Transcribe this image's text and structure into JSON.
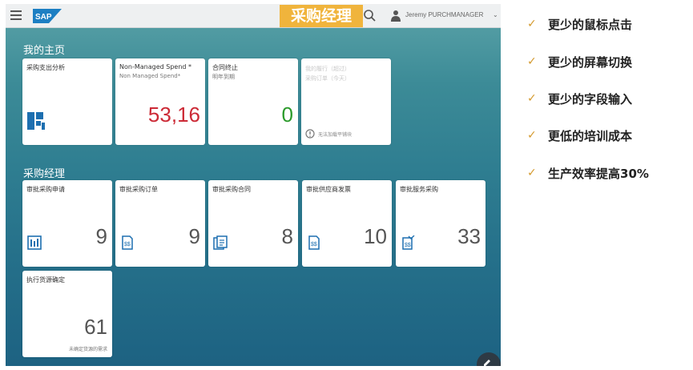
{
  "shell": {
    "logo_text": "SAP",
    "title": "采购经理",
    "user_name": "Jeremy PURCHMANAGER",
    "chevron": "⌄"
  },
  "home_group": {
    "title": "我的主页",
    "tiles": [
      {
        "title": "采购支出分析",
        "icon": "analytics-icon"
      },
      {
        "title": "Non-Managed Spend *",
        "subtitle": "Non Managed Spend*",
        "value": "53,16",
        "value_color": "#cc2a36"
      },
      {
        "title": "合同终止",
        "subtitle": "明年到期",
        "value": "0",
        "value_color": "#2b9a2b"
      },
      {
        "faded_lines": [
          "我的履行（超过）",
          "采购订单（今天）"
        ],
        "warning": "无法加载平铺块"
      }
    ]
  },
  "purchasing_group": {
    "title": "采购经理",
    "tiles": [
      {
        "title": "审批采购申请",
        "value": "9",
        "icon": "requisition-icon"
      },
      {
        "title": "审批采购订单",
        "value": "9",
        "icon": "purchase-order-icon"
      },
      {
        "title": "审批采购合同",
        "value": "8",
        "icon": "contract-icon"
      },
      {
        "title": "审批供应商发票",
        "value": "10",
        "icon": "invoice-icon"
      },
      {
        "title": "审批服务采购",
        "value": "33",
        "icon": "service-icon"
      },
      {
        "title": "执行货源确定",
        "value": "61",
        "footer": "未确定货源的需求"
      }
    ]
  },
  "benefits": [
    {
      "check": "✓",
      "text": "更少的鼠标点击"
    },
    {
      "check": "✓",
      "text": "更少的屏幕切换"
    },
    {
      "check": "✓",
      "text": "更少的字段输入"
    },
    {
      "check": "✓",
      "text": "更低的培训成本"
    },
    {
      "check": "✓",
      "text": "生产效率提高30%"
    }
  ],
  "colors": {
    "accent": "#f0b43c",
    "icon_blue": "#1d6fb0",
    "check": "#d49a2e"
  }
}
